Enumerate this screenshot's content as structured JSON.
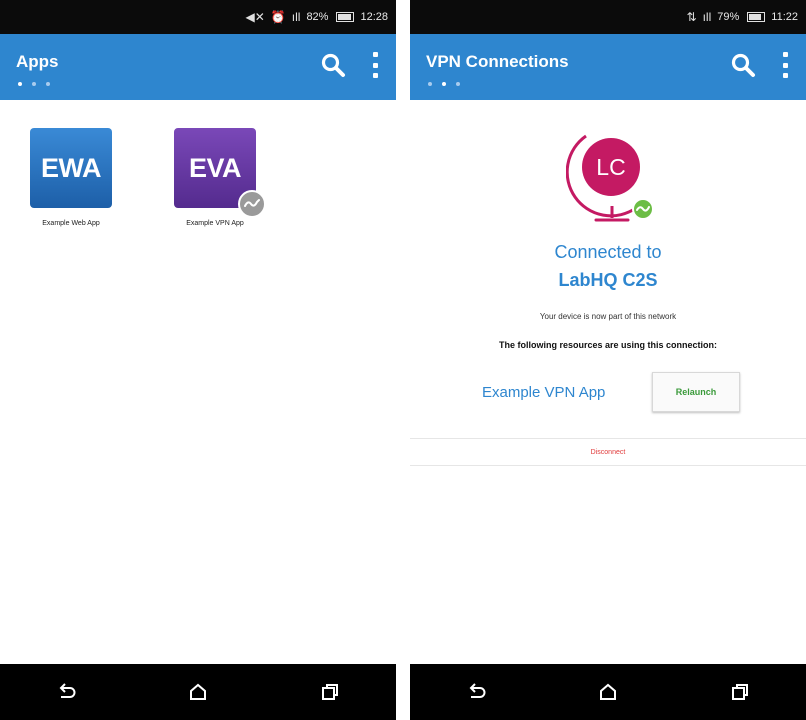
{
  "left": {
    "status": {
      "signal": "ıll",
      "battery": "82%",
      "time": "12:28"
    },
    "appbar": {
      "title": "Apps",
      "page_count": 3,
      "active_page": 0
    },
    "apps": [
      {
        "abbr": "EWA",
        "name": "Example Web App",
        "color": "#1d5fa8"
      },
      {
        "abbr": "EVA",
        "name": "Example VPN App",
        "color": "#542b8e",
        "badge": "vpn-status-icon"
      }
    ]
  },
  "right": {
    "status": {
      "signal": "ıll",
      "battery": "79%",
      "time": "11:22"
    },
    "appbar": {
      "title": "VPN Connections",
      "page_count": 3,
      "active_page": 1
    },
    "connection": {
      "logo_text": "LC",
      "connected_label": "Connected to",
      "name": "LabHQ C2S",
      "info": "Your device is now part of this network",
      "resources_label": "The following resources are using this connection:",
      "resource_app": "Example VPN App",
      "relaunch_label": "Relaunch",
      "disconnect_label": "Disconnect"
    }
  },
  "colors": {
    "appbar": "#2e86cf",
    "accent": "#2e86cf",
    "logo": "#c41a63",
    "ok": "#6cbd45",
    "danger": "#e03a3a",
    "relaunch": "#3a9a3a"
  }
}
